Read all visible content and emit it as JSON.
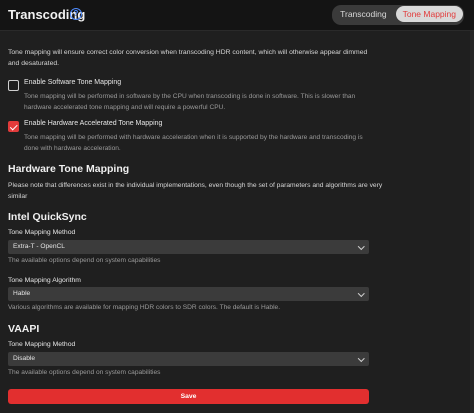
{
  "header": {
    "title": "Transcoding",
    "tabs": [
      {
        "label": "Transcoding",
        "active": false
      },
      {
        "label": "Tone Mapping",
        "active": true
      }
    ]
  },
  "intro": "Tone mapping will ensure correct color conversion when transcoding HDR content, which will otherwise appear dimmed and desaturated.",
  "software_tm": {
    "label": "Enable Software Tone Mapping",
    "checked": false,
    "description": "Tone mapping will be performed in software by the CPU when transcoding is done in software. This is slower than hardware accelerated tone mapping and will require a powerful CPU."
  },
  "hardware_tm": {
    "label": "Enable Hardware Accelerated Tone Mapping",
    "checked": true,
    "description": "Tone mapping will be performed with hardware acceleration when it is supported by the hardware and transcoding is done with hardware acceleration."
  },
  "hardware_section": {
    "heading": "Hardware Tone Mapping",
    "note": "Please note that differences exist in the individual implementations, even though the set of parameters and algorithms are very similar"
  },
  "quicksync": {
    "heading": "Intel QuickSync",
    "method_label": "Tone Mapping Method",
    "method_value": "Extra-T - OpenCL",
    "method_hint": "The available options depend on system capabilities",
    "algorithm_label": "Tone Mapping Algorithm",
    "algorithm_value": "Hable",
    "algorithm_hint": "Various algorithms are available for mapping HDR colors to SDR colors. The default is Hable."
  },
  "vaapi": {
    "heading": "VAAPI",
    "method_label": "Tone Mapping Method",
    "method_value": "Disable",
    "method_hint": "The available options depend on system capabilities"
  },
  "save_label": "Save",
  "colors": {
    "accent": "#e22f2f",
    "background": "#1f1f1f",
    "header": "#141414",
    "help_icon": "#4f8cff"
  }
}
